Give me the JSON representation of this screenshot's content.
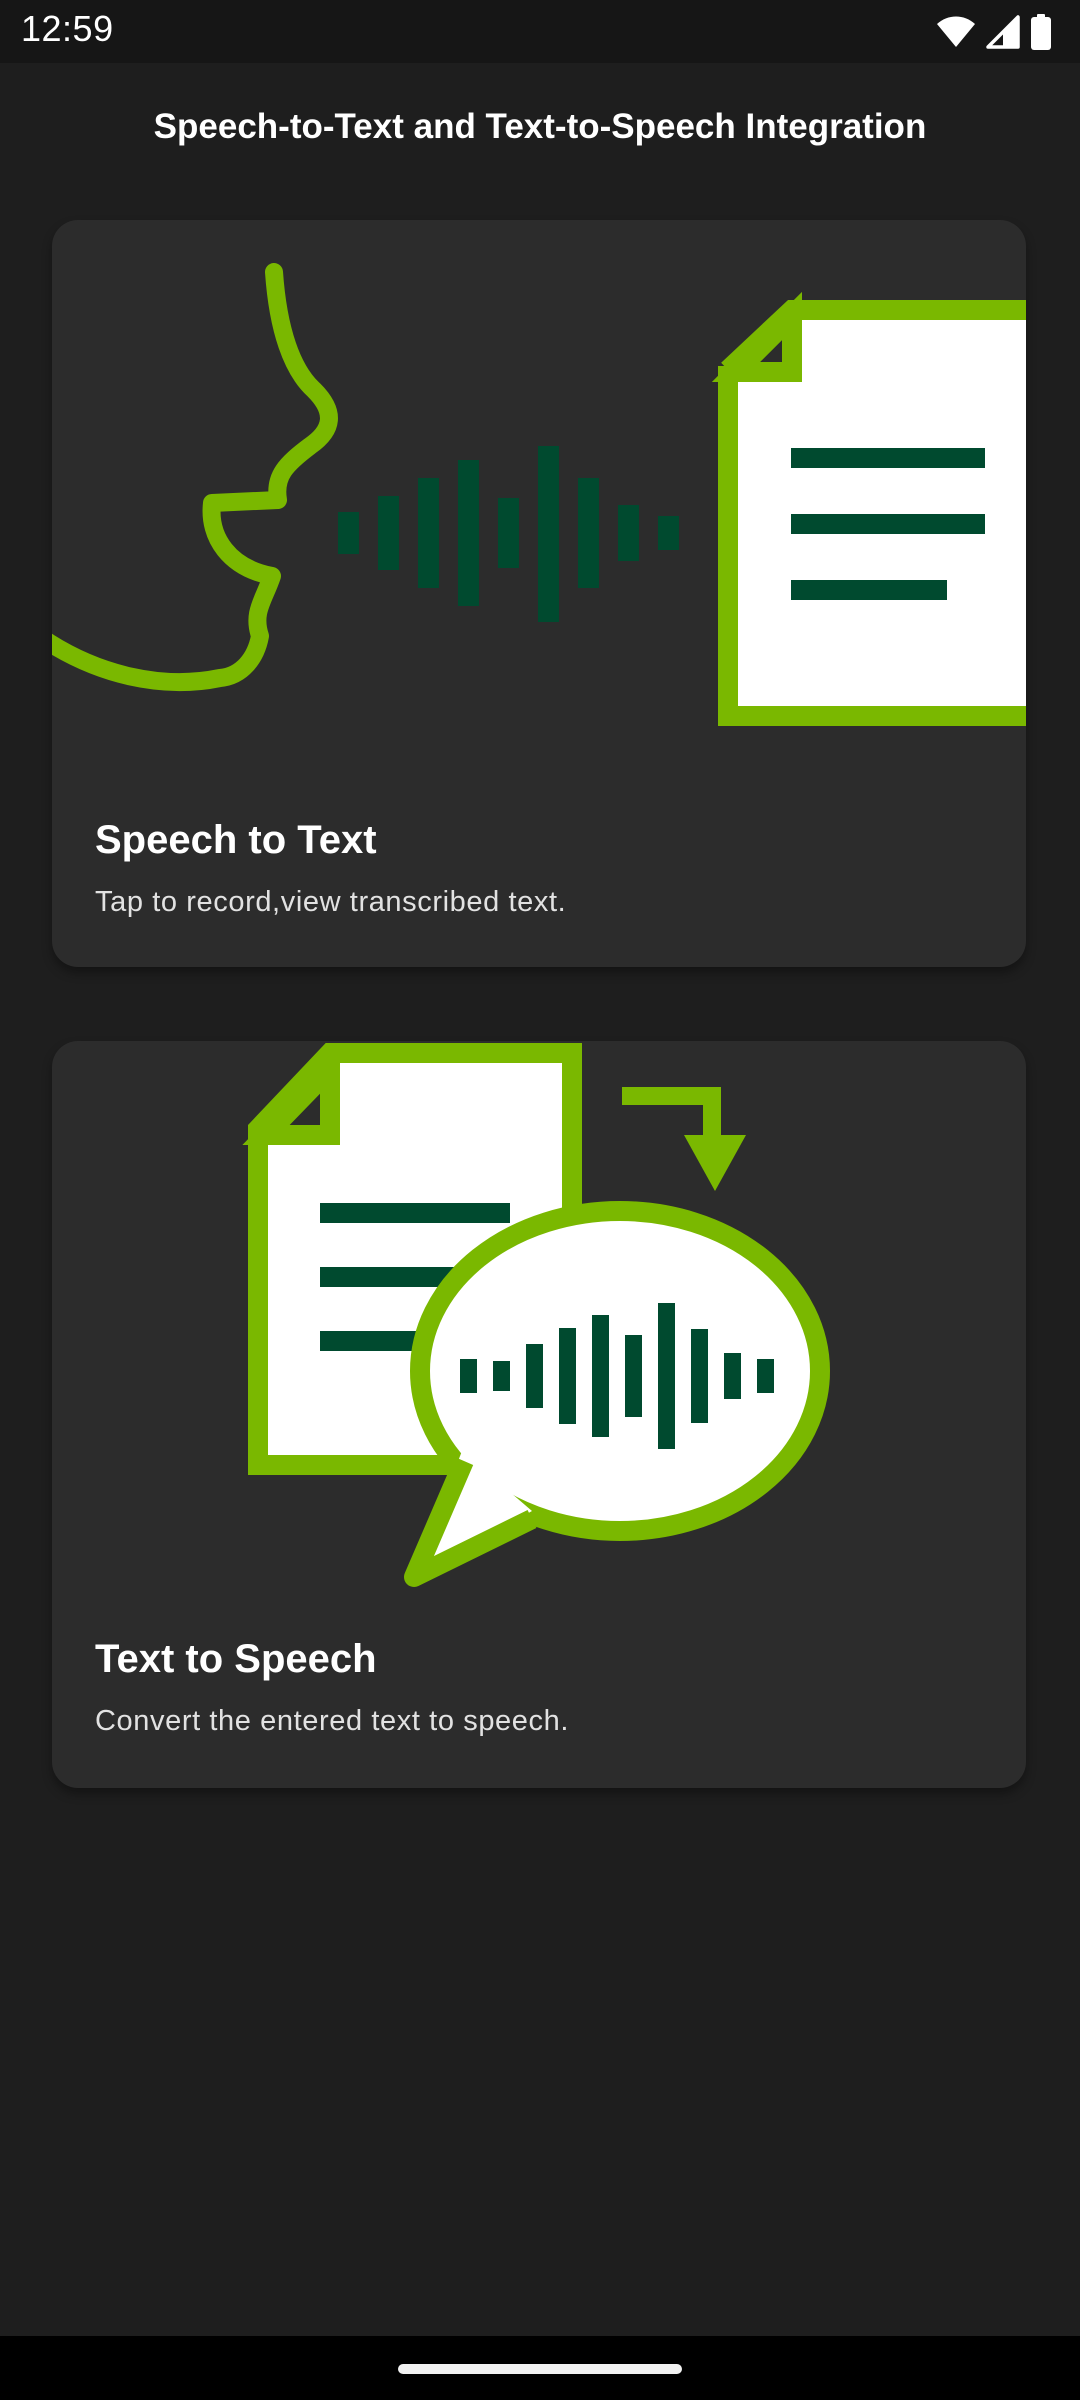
{
  "status_bar": {
    "time": "12:59",
    "icons": [
      "wifi-icon",
      "cellular-signal-icon",
      "battery-icon"
    ]
  },
  "app": {
    "title": "Speech-to-Text and Text-to-Speech Integration"
  },
  "cards": [
    {
      "title": "Speech to Text",
      "description": "Tap to record,view transcribed text.",
      "illustration": "speech-to-text-illustration"
    },
    {
      "title": "Text to Speech",
      "description": "Convert the entered text to speech.",
      "illustration": "text-to-speech-illustration"
    }
  ],
  "colors": {
    "background": "#1e1e1e",
    "card": "#2c2c2c",
    "accent_green": "#7ab800",
    "dark_green": "#004a2f"
  }
}
